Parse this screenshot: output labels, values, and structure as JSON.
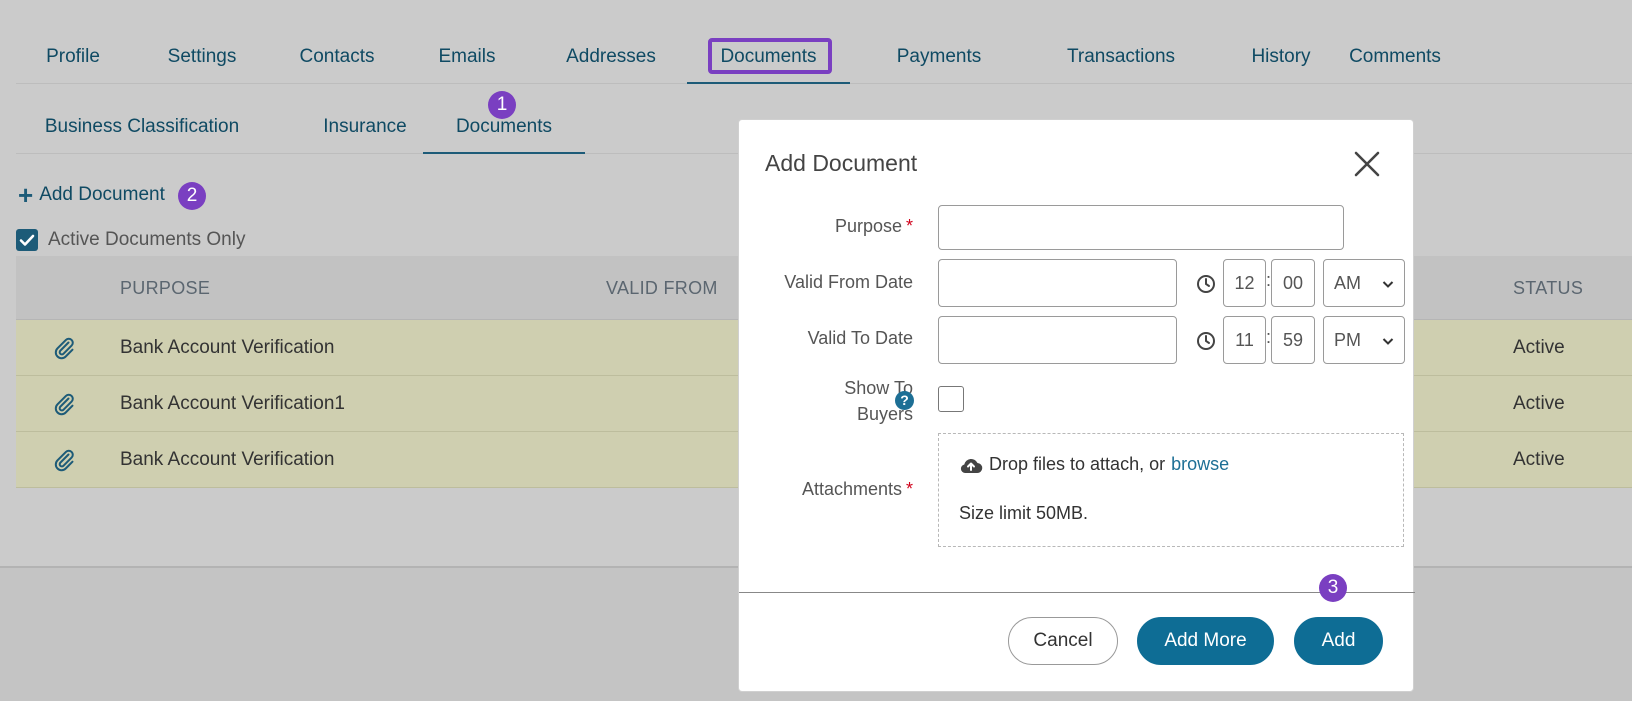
{
  "tabs_primary": [
    "Profile",
    "Settings",
    "Contacts",
    "Emails",
    "Addresses",
    "Documents",
    "Payments",
    "Transactions",
    "History",
    "Comments"
  ],
  "tabs_secondary": [
    "Business Classification",
    "Insurance",
    "Documents"
  ],
  "badges": {
    "b1": "1",
    "b2": "2",
    "b3": "3"
  },
  "toolbar": {
    "add_document": "Add Document",
    "active_only": "Active Documents Only"
  },
  "table": {
    "headers": {
      "purpose": "PURPOSE",
      "valid_from": "VALID FROM",
      "status": "STATUS"
    },
    "rows": [
      {
        "purpose": "Bank Account Verification",
        "status": "Active"
      },
      {
        "purpose": "Bank Account Verification1",
        "status": "Active"
      },
      {
        "purpose": "Bank Account Verification",
        "status": "Active"
      }
    ]
  },
  "modal": {
    "title": "Add Document",
    "labels": {
      "purpose": "Purpose",
      "valid_from": "Valid From Date",
      "valid_to": "Valid To Date",
      "show_line1": "Show To",
      "show_line2": "Buyers",
      "attachments": "Attachments",
      "required_mark": "*",
      "help": "?"
    },
    "from_time": {
      "hour": "12",
      "minute": "00",
      "ampm": "AM"
    },
    "to_time": {
      "hour": "11",
      "minute": "59",
      "ampm": "PM"
    },
    "time_separator": ":",
    "dropzone": {
      "text": "Drop files to attach, or",
      "link": "browse",
      "size_limit": "Size limit 50MB."
    },
    "buttons": {
      "cancel": "Cancel",
      "add_more": "Add More",
      "add": "Add"
    }
  },
  "colors": {
    "accent": "#0e6d95",
    "highlight": "#7a3fc1",
    "row_highlight": "#cfcfb0",
    "required": "#d0021b"
  }
}
